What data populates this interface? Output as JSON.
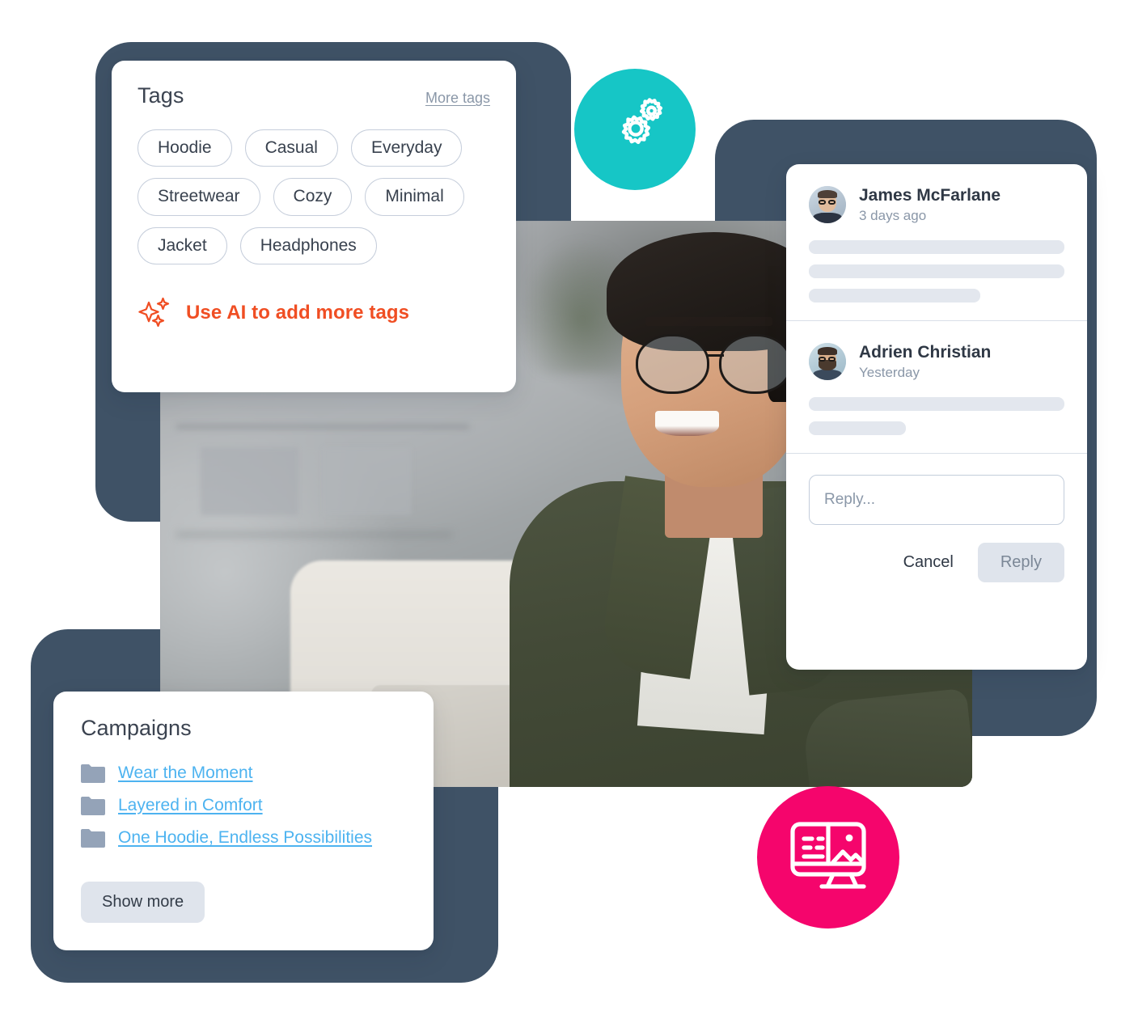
{
  "tags_panel": {
    "title": "Tags",
    "more_link": "More tags",
    "chips": [
      "Hoodie",
      "Casual",
      "Everyday",
      "Streetwear",
      "Cozy",
      "Minimal",
      "Jacket",
      "Headphones"
    ],
    "ai_action": "Use AI to add more tags",
    "ai_icon": "sparkles-icon",
    "accent_color": "#f04e23"
  },
  "comments_panel": {
    "comments": [
      {
        "author": "James McFarlane",
        "timestamp": "3 days ago",
        "avatar_icon": "user-avatar",
        "body_lines": [
          100,
          100,
          38
        ]
      },
      {
        "author": "Adrien Christian",
        "timestamp": "Yesterday",
        "avatar_icon": "user-avatar",
        "body_lines": [
          100,
          38
        ]
      }
    ],
    "reply": {
      "placeholder": "Reply...",
      "value": "",
      "cancel_label": "Cancel",
      "submit_label": "Reply"
    }
  },
  "campaigns_panel": {
    "title": "Campaigns",
    "items": [
      {
        "label": "Wear the Moment",
        "icon": "folder-icon"
      },
      {
        "label": "Layered in Comfort",
        "icon": "folder-icon"
      },
      {
        "label": "One Hoodie, Endless Possibilities",
        "icon": "folder-icon"
      }
    ],
    "show_more_label": "Show more",
    "link_color": "#4db3f0"
  },
  "badges": [
    {
      "icon": "gears-icon",
      "color": "#16c6c6"
    },
    {
      "icon": "monitor-media-icon",
      "color": "#f5056c"
    }
  ],
  "media": {
    "alt": "smiling-man-with-glasses-at-laptop",
    "icon": "photo-preview"
  },
  "theme": {
    "frame_color": "#3f5266",
    "card_bg": "#ffffff",
    "text_primary": "#2f3845",
    "text_muted": "#8a97a8",
    "skeleton": "#e3e7ee",
    "chip_border": "#c6cedb"
  }
}
